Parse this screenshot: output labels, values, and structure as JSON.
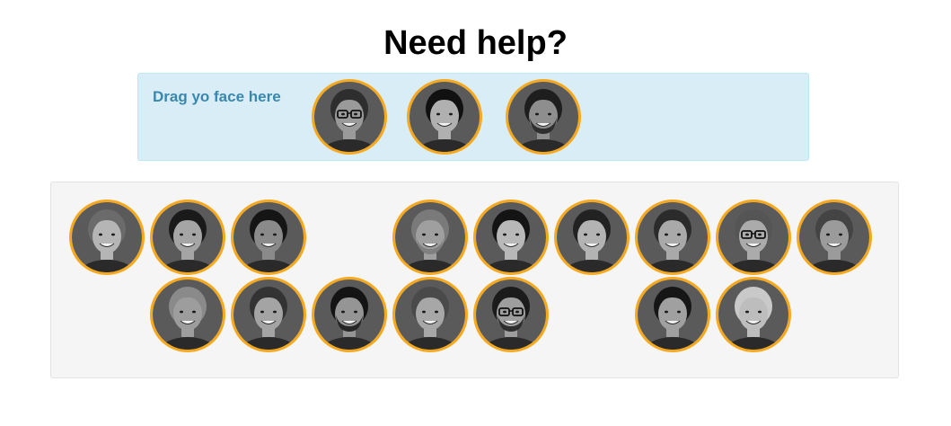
{
  "page": {
    "title": "Need help?"
  },
  "drop_zone": {
    "label": "Drag yo face here",
    "faces": [
      {
        "id": "z1",
        "hair": "#2e2e2e",
        "skin": "#9a9a9a",
        "glasses": true,
        "beard": false
      },
      {
        "id": "z2",
        "hair": "#111111",
        "skin": "#b0b0b0",
        "glasses": false,
        "beard": false
      },
      {
        "id": "z3",
        "hair": "#1e1e1e",
        "skin": "#8e8e8e",
        "glasses": false,
        "beard": true
      }
    ]
  },
  "pool": {
    "row1": [
      {
        "id": "p1",
        "hair": "#6b6b6b",
        "skin": "#b5b5b5",
        "glasses": false,
        "beard": false
      },
      {
        "id": "p2",
        "hair": "#1a1a1a",
        "skin": "#a5a5a5",
        "glasses": false,
        "beard": false
      },
      {
        "id": "p3",
        "hair": "#151515",
        "skin": "#8a8a8a",
        "glasses": false,
        "beard": false
      },
      null,
      {
        "id": "p4",
        "hair": "#7a7a7a",
        "skin": "#9f9f9f",
        "glasses": false,
        "beard": true
      },
      {
        "id": "p5",
        "hair": "#141414",
        "skin": "#b8b8b8",
        "glasses": false,
        "beard": false
      },
      {
        "id": "p6",
        "hair": "#222222",
        "skin": "#b3b3b3",
        "glasses": false,
        "beard": false
      },
      {
        "id": "p7",
        "hair": "#2b2b2b",
        "skin": "#a9a9a9",
        "glasses": false,
        "beard": false
      },
      {
        "id": "p8",
        "hair": "#555555",
        "skin": "#ababab",
        "glasses": true,
        "beard": false
      },
      {
        "id": "p9",
        "hair": "#444444",
        "skin": "#9b9b9b",
        "glasses": false,
        "beard": false
      }
    ],
    "row2": [
      null,
      {
        "id": "p10",
        "hair": "#8a8a8a",
        "skin": "#9d9d9d",
        "glasses": false,
        "beard": false
      },
      {
        "id": "p11",
        "hair": "#333333",
        "skin": "#a4a4a4",
        "glasses": false,
        "beard": false
      },
      {
        "id": "p12",
        "hair": "#141414",
        "skin": "#959595",
        "glasses": false,
        "beard": true
      },
      {
        "id": "p13",
        "hair": "#4a4a4a",
        "skin": "#a7a7a7",
        "glasses": false,
        "beard": false
      },
      {
        "id": "p14",
        "hair": "#1b1b1b",
        "skin": "#9e9e9e",
        "glasses": true,
        "beard": true
      },
      null,
      {
        "id": "p15",
        "hair": "#161616",
        "skin": "#a0a0a0",
        "glasses": false,
        "beard": false
      },
      {
        "id": "p16",
        "hair": "#c9c9c9",
        "skin": "#bdbdbd",
        "glasses": false,
        "beard": false
      }
    ]
  },
  "colors": {
    "face_border": "#f7a81b",
    "drop_bg": "#d9edf7",
    "drop_text": "#3a87ad",
    "pool_bg": "#f5f5f5"
  }
}
